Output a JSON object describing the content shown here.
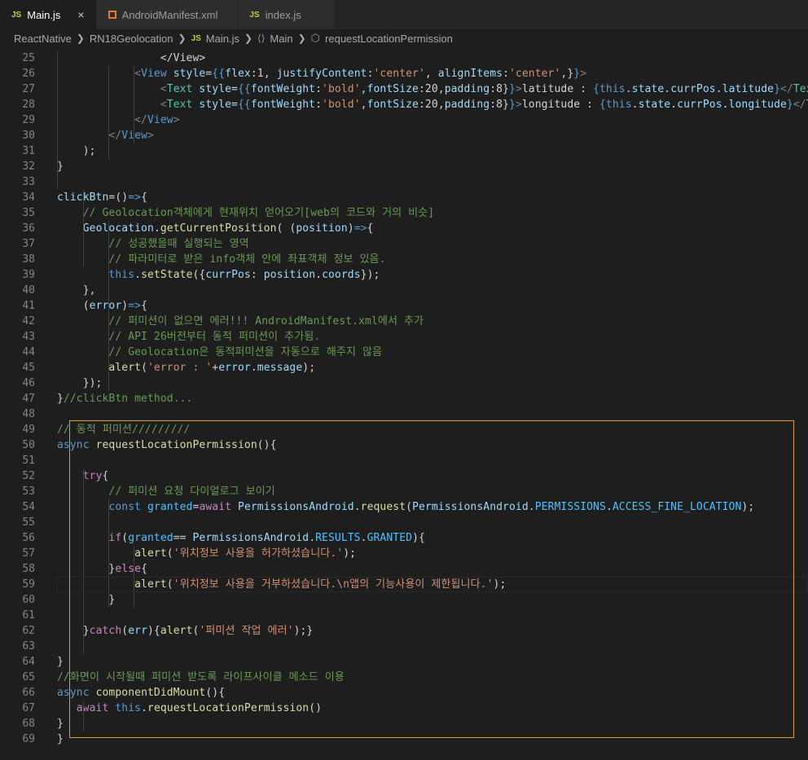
{
  "tabs": [
    {
      "icon": "JS",
      "label": "Main.js",
      "active": true,
      "close": "×"
    },
    {
      "icon": "xml",
      "label": "AndroidManifest.xml",
      "active": false
    },
    {
      "icon": "JS",
      "label": "index.js",
      "active": false
    }
  ],
  "breadcrumb": {
    "items": [
      "ReactNative",
      "RN18Geolocation",
      "Main.js",
      "Main",
      "requestLocationPermission"
    ],
    "file_icon": "JS"
  },
  "colors": {
    "background": "#1e1e1e",
    "selection_border": "#d7a13e",
    "keyword": "#569cd6",
    "string": "#ce9178",
    "comment": "#6a9955"
  },
  "editor": {
    "lines": [
      {
        "n": "25",
        "tokens": [
          [
            "",
            "                </View>"
          ]
        ]
      },
      {
        "n": "26",
        "tokens": [
          [
            "",
            "            "
          ],
          [
            "c-tagpunc",
            "<"
          ],
          [
            "c-tag",
            "View"
          ],
          [
            "c-var",
            " style"
          ],
          [
            "",
            "="
          ],
          [
            "c-kw",
            "{{"
          ],
          [
            "c-var",
            "flex"
          ],
          [
            "",
            ":1, "
          ],
          [
            "c-var",
            "justifyContent"
          ],
          [
            "",
            ":"
          ],
          [
            "c-str",
            "'center'"
          ],
          [
            "",
            ", "
          ],
          [
            "c-var",
            "alignItems"
          ],
          [
            "",
            ":"
          ],
          [
            "c-str",
            "'center'"
          ],
          [
            "",
            ",}"
          ],
          [
            "c-kw",
            "}"
          ],
          [
            "c-tagpunc",
            ">"
          ]
        ]
      },
      {
        "n": "27",
        "tokens": [
          [
            "",
            "                "
          ],
          [
            "c-tagpunc",
            "<"
          ],
          [
            "c-cls",
            "Text"
          ],
          [
            "c-var",
            " style"
          ],
          [
            "",
            "="
          ],
          [
            "c-kw",
            "{{"
          ],
          [
            "c-var",
            "fontWeight"
          ],
          [
            "",
            ":"
          ],
          [
            "c-str",
            "'bold'"
          ],
          [
            "",
            ","
          ],
          [
            "c-var",
            "fontSize"
          ],
          [
            "",
            ":20,"
          ],
          [
            "c-var",
            "padding"
          ],
          [
            "",
            ":8}"
          ],
          [
            "c-kw",
            "}"
          ],
          [
            "c-tagpunc",
            ">"
          ],
          [
            "",
            "latitude : "
          ],
          [
            "c-kw",
            "{this"
          ],
          [
            "",
            "."
          ],
          [
            "c-var",
            "state"
          ],
          [
            "",
            "."
          ],
          [
            "c-var",
            "currPos"
          ],
          [
            "",
            "."
          ],
          [
            "c-var",
            "latitude"
          ],
          [
            "c-kw",
            "}"
          ],
          [
            "c-tagpunc",
            "</"
          ],
          [
            "c-cls",
            "Text"
          ],
          [
            "c-tagpunc",
            ">"
          ]
        ]
      },
      {
        "n": "28",
        "tokens": [
          [
            "",
            "                "
          ],
          [
            "c-tagpunc",
            "<"
          ],
          [
            "c-cls",
            "Text"
          ],
          [
            "c-var",
            " style"
          ],
          [
            "",
            "="
          ],
          [
            "c-kw",
            "{{"
          ],
          [
            "c-var",
            "fontWeight"
          ],
          [
            "",
            ":"
          ],
          [
            "c-str",
            "'bold'"
          ],
          [
            "",
            ","
          ],
          [
            "c-var",
            "fontSize"
          ],
          [
            "",
            ":20,"
          ],
          [
            "c-var",
            "padding"
          ],
          [
            "",
            ":8}"
          ],
          [
            "c-kw",
            "}"
          ],
          [
            "c-tagpunc",
            ">"
          ],
          [
            "",
            "longitude : "
          ],
          [
            "c-kw",
            "{this"
          ],
          [
            "",
            "."
          ],
          [
            "c-var",
            "state"
          ],
          [
            "",
            "."
          ],
          [
            "c-var",
            "currPos"
          ],
          [
            "",
            "."
          ],
          [
            "c-var",
            "longitude"
          ],
          [
            "c-kw",
            "}"
          ],
          [
            "c-tagpunc",
            "</"
          ],
          [
            "c-cls",
            "Text"
          ],
          [
            "c-tagpunc",
            ">"
          ]
        ]
      },
      {
        "n": "29",
        "tokens": [
          [
            "",
            "            "
          ],
          [
            "c-tagpunc",
            "</"
          ],
          [
            "c-tag",
            "View"
          ],
          [
            "c-tagpunc",
            ">"
          ]
        ]
      },
      {
        "n": "30",
        "tokens": [
          [
            "",
            "        "
          ],
          [
            "c-tagpunc",
            "</"
          ],
          [
            "c-tag",
            "View"
          ],
          [
            "c-tagpunc",
            ">"
          ]
        ]
      },
      {
        "n": "31",
        "tokens": [
          [
            "",
            "    );"
          ]
        ]
      },
      {
        "n": "32",
        "tokens": [
          [
            "",
            "}"
          ]
        ]
      },
      {
        "n": "33",
        "tokens": [
          [
            "",
            ""
          ]
        ]
      },
      {
        "n": "34",
        "tokens": [
          [
            "c-var",
            "clickBtn"
          ],
          [
            "",
            "=()"
          ],
          [
            "c-kw",
            "=>"
          ],
          [
            "",
            "{"
          ]
        ]
      },
      {
        "n": "35",
        "tokens": [
          [
            "",
            "    "
          ],
          [
            "c-cmt",
            "// Geolocation객체에게 현재위치 얻어오기[web의 코드와 거의 비슷]"
          ]
        ]
      },
      {
        "n": "36",
        "tokens": [
          [
            "",
            "    "
          ],
          [
            "c-var",
            "Geolocation"
          ],
          [
            "",
            "."
          ],
          [
            "c-fn",
            "getCurrentPosition"
          ],
          [
            "",
            "( ("
          ],
          [
            "c-var",
            "position"
          ],
          [
            "",
            ")"
          ],
          [
            "c-kw",
            "=>"
          ],
          [
            "",
            "{"
          ]
        ]
      },
      {
        "n": "37",
        "tokens": [
          [
            "",
            "        "
          ],
          [
            "c-cmt",
            "// 성공했을때 실행되는 영역"
          ]
        ]
      },
      {
        "n": "38",
        "tokens": [
          [
            "",
            "        "
          ],
          [
            "c-cmt",
            "// 파라미터로 받은 info객체 안에 좌표객체 정보 있음."
          ]
        ]
      },
      {
        "n": "39",
        "tokens": [
          [
            "",
            "        "
          ],
          [
            "c-kw",
            "this"
          ],
          [
            "",
            "."
          ],
          [
            "c-fn",
            "setState"
          ],
          [
            "",
            "({"
          ],
          [
            "c-var",
            "currPos"
          ],
          [
            "",
            ": "
          ],
          [
            "c-var",
            "position"
          ],
          [
            "",
            "."
          ],
          [
            "c-var",
            "coords"
          ],
          [
            "",
            "});"
          ]
        ]
      },
      {
        "n": "40",
        "tokens": [
          [
            "",
            "    },"
          ]
        ]
      },
      {
        "n": "41",
        "tokens": [
          [
            "",
            "    ("
          ],
          [
            "c-var",
            "error"
          ],
          [
            "",
            ")"
          ],
          [
            "c-kw",
            "=>"
          ],
          [
            "",
            "{"
          ]
        ]
      },
      {
        "n": "42",
        "tokens": [
          [
            "",
            "        "
          ],
          [
            "c-cmt",
            "// 퍼미션이 없으면 에러!!! AndroidManifest.xml에서 추가"
          ]
        ]
      },
      {
        "n": "43",
        "tokens": [
          [
            "",
            "        "
          ],
          [
            "c-cmt",
            "// API 26버전부터 동적 퍼미션이 추가됨."
          ]
        ]
      },
      {
        "n": "44",
        "tokens": [
          [
            "",
            "        "
          ],
          [
            "c-cmt",
            "// Geolocation은 동적퍼미션을 자동으로 해주지 않음"
          ]
        ]
      },
      {
        "n": "45",
        "tokens": [
          [
            "",
            "        "
          ],
          [
            "c-fn",
            "alert"
          ],
          [
            "",
            "("
          ],
          [
            "c-str",
            "'error : '"
          ],
          [
            "",
            "+"
          ],
          [
            "c-var",
            "error"
          ],
          [
            "",
            "."
          ],
          [
            "c-var",
            "message"
          ],
          [
            "",
            ");"
          ]
        ]
      },
      {
        "n": "46",
        "tokens": [
          [
            "",
            "    });"
          ]
        ]
      },
      {
        "n": "47",
        "tokens": [
          [
            "",
            "}"
          ],
          [
            "c-cmt",
            "//clickBtn method..."
          ]
        ]
      },
      {
        "n": "48",
        "tokens": [
          [
            "",
            ""
          ]
        ]
      },
      {
        "n": "49",
        "tokens": [
          [
            "c-cmt",
            "// 동적 퍼미션/////////"
          ]
        ]
      },
      {
        "n": "50",
        "tokens": [
          [
            "c-kw",
            "async"
          ],
          [
            "",
            " "
          ],
          [
            "c-fn",
            "requestLocationPermission"
          ],
          [
            "",
            "(){"
          ]
        ]
      },
      {
        "n": "51",
        "tokens": [
          [
            "",
            ""
          ]
        ]
      },
      {
        "n": "52",
        "tokens": [
          [
            "",
            "    "
          ],
          [
            "c-ctl",
            "try"
          ],
          [
            "",
            "{"
          ]
        ]
      },
      {
        "n": "53",
        "tokens": [
          [
            "",
            "        "
          ],
          [
            "c-cmt",
            "// 퍼미션 요청 다이얼로그 보이기"
          ]
        ]
      },
      {
        "n": "54",
        "tokens": [
          [
            "",
            "        "
          ],
          [
            "c-kw",
            "const"
          ],
          [
            "",
            " "
          ],
          [
            "c-const",
            "granted"
          ],
          [
            "",
            "="
          ],
          [
            "c-ctl",
            "await"
          ],
          [
            "",
            " "
          ],
          [
            "c-var",
            "PermissionsAndroid"
          ],
          [
            "",
            "."
          ],
          [
            "c-fn",
            "request"
          ],
          [
            "",
            "("
          ],
          [
            "c-var",
            "PermissionsAndroid"
          ],
          [
            "",
            "."
          ],
          [
            "c-const",
            "PERMISSIONS"
          ],
          [
            "",
            "."
          ],
          [
            "c-const",
            "ACCESS_FINE_LOCATION"
          ],
          [
            "",
            ");"
          ]
        ]
      },
      {
        "n": "55",
        "tokens": [
          [
            "",
            ""
          ]
        ]
      },
      {
        "n": "56",
        "tokens": [
          [
            "",
            "        "
          ],
          [
            "c-ctl",
            "if"
          ],
          [
            "",
            "("
          ],
          [
            "c-const",
            "granted"
          ],
          [
            "",
            "== "
          ],
          [
            "c-var",
            "PermissionsAndroid"
          ],
          [
            "",
            "."
          ],
          [
            "c-const",
            "RESULTS"
          ],
          [
            "",
            "."
          ],
          [
            "c-const",
            "GRANTED"
          ],
          [
            "",
            "){"
          ]
        ]
      },
      {
        "n": "57",
        "tokens": [
          [
            "",
            "            "
          ],
          [
            "c-fn",
            "alert"
          ],
          [
            "",
            "("
          ],
          [
            "c-str",
            "'위치정보 사용을 허가하셨습니다.'"
          ],
          [
            "",
            ");"
          ]
        ]
      },
      {
        "n": "58",
        "tokens": [
          [
            "",
            "        }"
          ],
          [
            "c-ctl",
            "else"
          ],
          [
            "",
            "{"
          ]
        ]
      },
      {
        "n": "59",
        "tokens": [
          [
            "",
            "            "
          ],
          [
            "c-fn",
            "alert"
          ],
          [
            "",
            "("
          ],
          [
            "c-str",
            "'위치정보 사용을 거부하셨습니다.\\n앱의 기능사용이 제한됩니다.'"
          ],
          [
            "",
            ");"
          ]
        ]
      },
      {
        "n": "60",
        "tokens": [
          [
            "",
            "        }"
          ]
        ]
      },
      {
        "n": "61",
        "tokens": [
          [
            "",
            ""
          ]
        ]
      },
      {
        "n": "62",
        "tokens": [
          [
            "",
            "    }"
          ],
          [
            "c-ctl",
            "catch"
          ],
          [
            "",
            "("
          ],
          [
            "c-var",
            "err"
          ],
          [
            "",
            "){"
          ],
          [
            "c-fn",
            "alert"
          ],
          [
            "",
            "("
          ],
          [
            "c-str",
            "'퍼미션 작업 에러'"
          ],
          [
            "",
            ");}"
          ]
        ]
      },
      {
        "n": "63",
        "tokens": [
          [
            "",
            ""
          ]
        ]
      },
      {
        "n": "64",
        "tokens": [
          [
            "",
            "}"
          ]
        ]
      },
      {
        "n": "65",
        "tokens": [
          [
            "c-cmt",
            "//화면이 시작될때 퍼미션 받도록 라이프사이클 메소드 이용"
          ]
        ]
      },
      {
        "n": "66",
        "tokens": [
          [
            "c-kw",
            "async"
          ],
          [
            "",
            " "
          ],
          [
            "c-fn",
            "componentDidMount"
          ],
          [
            "",
            "(){"
          ]
        ]
      },
      {
        "n": "67",
        "tokens": [
          [
            "",
            "   "
          ],
          [
            "c-ctl",
            "await"
          ],
          [
            "",
            " "
          ],
          [
            "c-kw",
            "this"
          ],
          [
            "",
            "."
          ],
          [
            "c-fn",
            "requestLocationPermission"
          ],
          [
            "",
            "()"
          ]
        ]
      },
      {
        "n": "68",
        "tokens": [
          [
            "",
            "}"
          ]
        ]
      },
      {
        "n": "69",
        "tokens": [
          [
            "",
            "}"
          ]
        ]
      }
    ]
  }
}
